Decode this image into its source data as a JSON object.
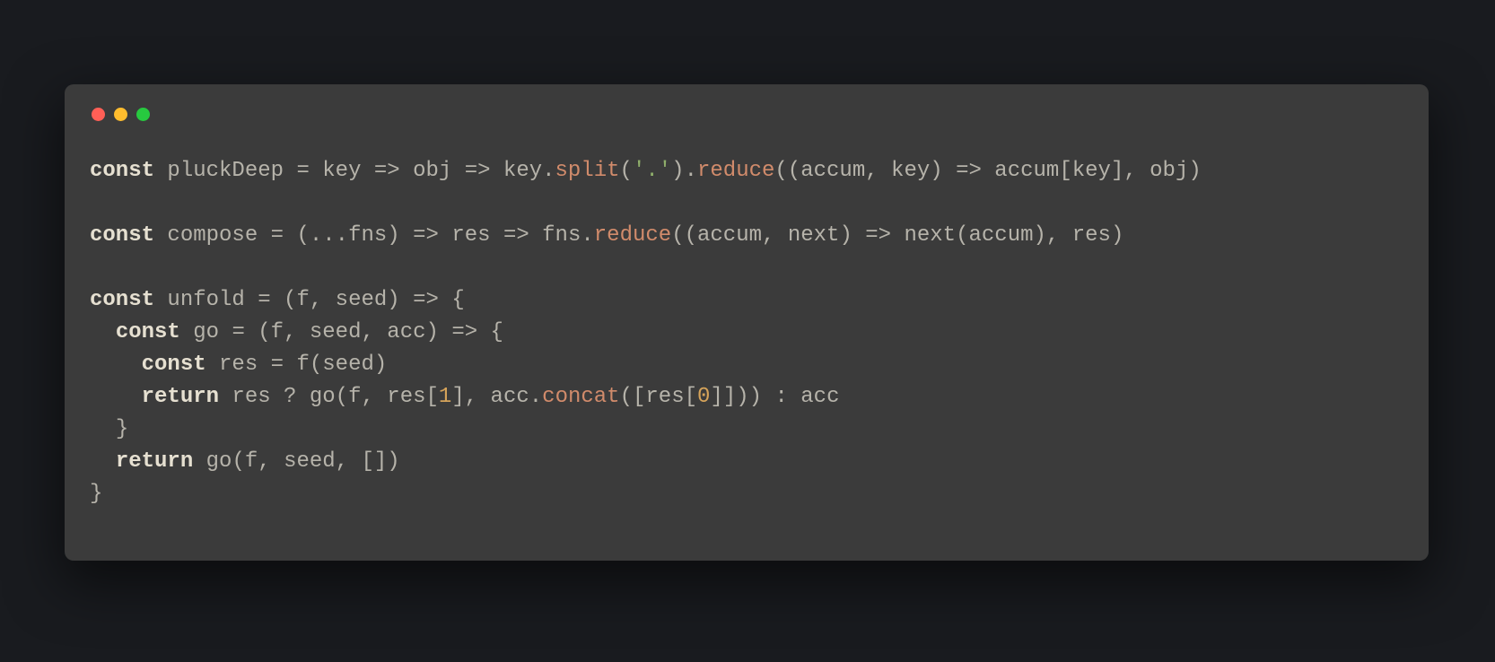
{
  "window": {
    "traffic_lights": {
      "red": "#ff5f56",
      "yellow": "#ffbd2e",
      "green": "#27c93f"
    }
  },
  "code": {
    "lines": [
      [
        {
          "c": "keyword",
          "t": "const"
        },
        {
          "c": "plain",
          "t": " pluckDeep "
        },
        {
          "c": "op",
          "t": "="
        },
        {
          "c": "plain",
          "t": " key "
        },
        {
          "c": "op",
          "t": "=>"
        },
        {
          "c": "plain",
          "t": " obj "
        },
        {
          "c": "op",
          "t": "=>"
        },
        {
          "c": "plain",
          "t": " key"
        },
        {
          "c": "punc",
          "t": "."
        },
        {
          "c": "method",
          "t": "split"
        },
        {
          "c": "punc",
          "t": "("
        },
        {
          "c": "string",
          "t": "'.'"
        },
        {
          "c": "punc",
          "t": ")"
        },
        {
          "c": "punc",
          "t": "."
        },
        {
          "c": "method",
          "t": "reduce"
        },
        {
          "c": "punc",
          "t": "(("
        },
        {
          "c": "plain",
          "t": "accum"
        },
        {
          "c": "punc",
          "t": ", "
        },
        {
          "c": "plain",
          "t": "key"
        },
        {
          "c": "punc",
          "t": ") "
        },
        {
          "c": "op",
          "t": "=>"
        },
        {
          "c": "plain",
          "t": " accum"
        },
        {
          "c": "punc",
          "t": "["
        },
        {
          "c": "plain",
          "t": "key"
        },
        {
          "c": "punc",
          "t": "], "
        },
        {
          "c": "plain",
          "t": "obj"
        },
        {
          "c": "punc",
          "t": ")"
        }
      ],
      [],
      [
        {
          "c": "keyword",
          "t": "const"
        },
        {
          "c": "plain",
          "t": " compose "
        },
        {
          "c": "op",
          "t": "="
        },
        {
          "c": "plain",
          "t": " "
        },
        {
          "c": "punc",
          "t": "("
        },
        {
          "c": "op",
          "t": "..."
        },
        {
          "c": "plain",
          "t": "fns"
        },
        {
          "c": "punc",
          "t": ") "
        },
        {
          "c": "op",
          "t": "=>"
        },
        {
          "c": "plain",
          "t": " res "
        },
        {
          "c": "op",
          "t": "=>"
        },
        {
          "c": "plain",
          "t": " fns"
        },
        {
          "c": "punc",
          "t": "."
        },
        {
          "c": "method",
          "t": "reduce"
        },
        {
          "c": "punc",
          "t": "(("
        },
        {
          "c": "plain",
          "t": "accum"
        },
        {
          "c": "punc",
          "t": ", "
        },
        {
          "c": "plain",
          "t": "next"
        },
        {
          "c": "punc",
          "t": ") "
        },
        {
          "c": "op",
          "t": "=>"
        },
        {
          "c": "plain",
          "t": " next"
        },
        {
          "c": "punc",
          "t": "("
        },
        {
          "c": "plain",
          "t": "accum"
        },
        {
          "c": "punc",
          "t": "), "
        },
        {
          "c": "plain",
          "t": "res"
        },
        {
          "c": "punc",
          "t": ")"
        }
      ],
      [],
      [
        {
          "c": "keyword",
          "t": "const"
        },
        {
          "c": "plain",
          "t": " unfold "
        },
        {
          "c": "op",
          "t": "="
        },
        {
          "c": "plain",
          "t": " "
        },
        {
          "c": "punc",
          "t": "("
        },
        {
          "c": "plain",
          "t": "f"
        },
        {
          "c": "punc",
          "t": ", "
        },
        {
          "c": "plain",
          "t": "seed"
        },
        {
          "c": "punc",
          "t": ") "
        },
        {
          "c": "op",
          "t": "=>"
        },
        {
          "c": "plain",
          "t": " "
        },
        {
          "c": "punc",
          "t": "{"
        }
      ],
      [
        {
          "c": "plain",
          "t": "  "
        },
        {
          "c": "keyword",
          "t": "const"
        },
        {
          "c": "plain",
          "t": " go "
        },
        {
          "c": "op",
          "t": "="
        },
        {
          "c": "plain",
          "t": " "
        },
        {
          "c": "punc",
          "t": "("
        },
        {
          "c": "plain",
          "t": "f"
        },
        {
          "c": "punc",
          "t": ", "
        },
        {
          "c": "plain",
          "t": "seed"
        },
        {
          "c": "punc",
          "t": ", "
        },
        {
          "c": "plain",
          "t": "acc"
        },
        {
          "c": "punc",
          "t": ") "
        },
        {
          "c": "op",
          "t": "=>"
        },
        {
          "c": "plain",
          "t": " "
        },
        {
          "c": "punc",
          "t": "{"
        }
      ],
      [
        {
          "c": "plain",
          "t": "    "
        },
        {
          "c": "keyword",
          "t": "const"
        },
        {
          "c": "plain",
          "t": " res "
        },
        {
          "c": "op",
          "t": "="
        },
        {
          "c": "plain",
          "t": " f"
        },
        {
          "c": "punc",
          "t": "("
        },
        {
          "c": "plain",
          "t": "seed"
        },
        {
          "c": "punc",
          "t": ")"
        }
      ],
      [
        {
          "c": "plain",
          "t": "    "
        },
        {
          "c": "keyword",
          "t": "return"
        },
        {
          "c": "plain",
          "t": " res "
        },
        {
          "c": "op",
          "t": "?"
        },
        {
          "c": "plain",
          "t": " go"
        },
        {
          "c": "punc",
          "t": "("
        },
        {
          "c": "plain",
          "t": "f"
        },
        {
          "c": "punc",
          "t": ", "
        },
        {
          "c": "plain",
          "t": "res"
        },
        {
          "c": "punc",
          "t": "["
        },
        {
          "c": "number",
          "t": "1"
        },
        {
          "c": "punc",
          "t": "], "
        },
        {
          "c": "plain",
          "t": "acc"
        },
        {
          "c": "punc",
          "t": "."
        },
        {
          "c": "method",
          "t": "concat"
        },
        {
          "c": "punc",
          "t": "(["
        },
        {
          "c": "plain",
          "t": "res"
        },
        {
          "c": "punc",
          "t": "["
        },
        {
          "c": "number",
          "t": "0"
        },
        {
          "c": "punc",
          "t": "]])) "
        },
        {
          "c": "op",
          "t": ":"
        },
        {
          "c": "plain",
          "t": " acc"
        }
      ],
      [
        {
          "c": "plain",
          "t": "  "
        },
        {
          "c": "punc",
          "t": "}"
        }
      ],
      [
        {
          "c": "plain",
          "t": "  "
        },
        {
          "c": "keyword",
          "t": "return"
        },
        {
          "c": "plain",
          "t": " go"
        },
        {
          "c": "punc",
          "t": "("
        },
        {
          "c": "plain",
          "t": "f"
        },
        {
          "c": "punc",
          "t": ", "
        },
        {
          "c": "plain",
          "t": "seed"
        },
        {
          "c": "punc",
          "t": ", [])"
        }
      ],
      [
        {
          "c": "punc",
          "t": "}"
        }
      ]
    ]
  }
}
